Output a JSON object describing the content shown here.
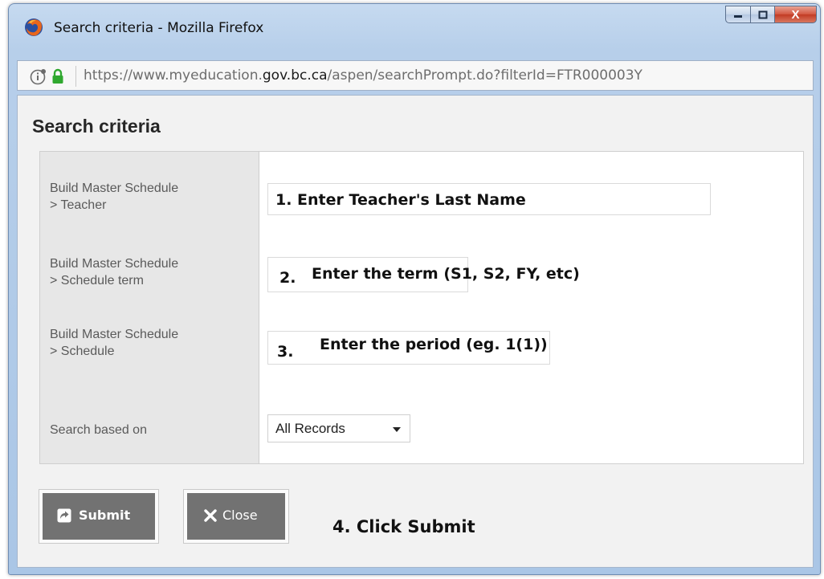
{
  "window": {
    "title": "Search criteria - Mozilla Firefox",
    "close_glyph": "X"
  },
  "address_bar": {
    "url_prefix": "https://www.myeducation.",
    "url_domain": "gov.bc.ca",
    "url_suffix": "/aspen/searchPrompt.do?filterId=FTR000003Y"
  },
  "dialog": {
    "heading": "Search criteria",
    "fields": [
      {
        "label_line1": "Build Master Schedule",
        "label_line2": "> Teacher",
        "annotation": "1.  Enter Teacher's Last Name"
      },
      {
        "label_line1": "Build Master Schedule",
        "label_line2": "> Schedule term",
        "annotation_num": "2.",
        "annotation": "Enter the term (S1, S2, FY, etc)"
      },
      {
        "label_line1": "Build Master Schedule",
        "label_line2": "> Schedule",
        "annotation_num": "3.",
        "annotation": "Enter the period (eg. 1(1))"
      }
    ],
    "search_based_on": {
      "label": "Search based on",
      "selected": "All Records"
    }
  },
  "buttons": {
    "submit": "Submit",
    "close": "Close"
  },
  "instruction": "4. Click Submit",
  "colors": {
    "button_bg": "#727272",
    "label_column_bg": "#e7e7e7",
    "lock_green": "#2fa82f",
    "window_frame": "#b7cfea"
  }
}
